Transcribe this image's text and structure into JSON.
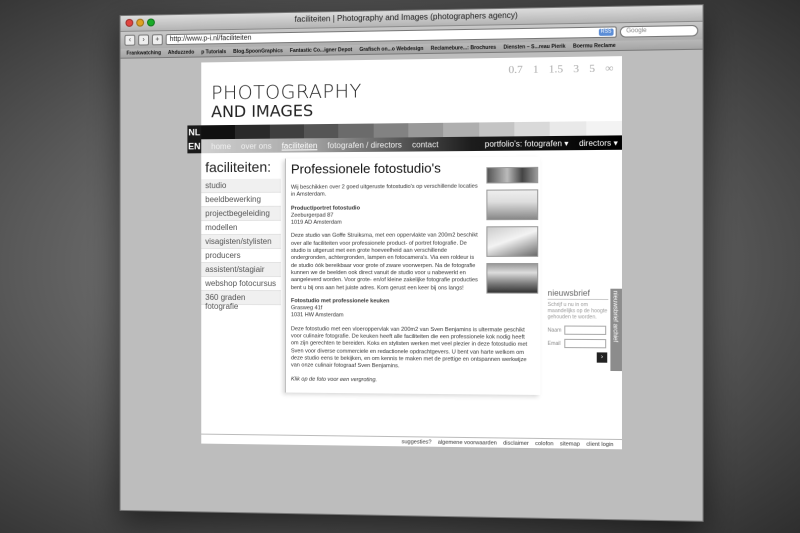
{
  "window": {
    "title": "faciliteiten | Photography and Images (photographers agency)",
    "url": "http://www.p-i.nl/faciliteiten",
    "rss_label": "RSS",
    "search_placeholder": "Google",
    "bookmarks": [
      "Frankwatching",
      "Ahduzzedo",
      "p Tutorials",
      "Blog.SpoonGraphics",
      "Fantastic Co...igner Depot",
      "Grafisch on...o Webdesign",
      "Reclamebure...: Brochures",
      "Diensten – S...reau Pierik",
      "Boermu Reclame"
    ]
  },
  "logo": {
    "line1": "PHOTOGRAPHY",
    "line2": "AND IMAGES"
  },
  "apertures": "0.7 1 1.5 3 5 ∞",
  "strip_colors": [
    "#111111",
    "#2a2a2a",
    "#3f3f3f",
    "#555555",
    "#6b6b6b",
    "#828282",
    "#999999",
    "#afafaf",
    "#c4c4c4",
    "#d9d9d9",
    "#e9e9e9",
    "#f3f3f3"
  ],
  "lang": {
    "nl": "NL",
    "en": "EN"
  },
  "nav": {
    "items": [
      "home",
      "over ons",
      "faciliteiten",
      "fotografen / directors",
      "contact"
    ],
    "active": "faciliteiten",
    "portfolio": "portfolio's: fotografen ▾",
    "directors": "directors ▾"
  },
  "sidebar": {
    "title": "faciliteiten:",
    "items": [
      "studio",
      "beeldbewerking",
      "projectbegeleiding",
      "modellen",
      "visagisten/stylisten",
      "producers",
      "assistent/stagiair",
      "webshop fotocursus",
      "360 graden fotografie"
    ]
  },
  "content": {
    "title": "Professionele fotostudio's",
    "intro": "Wij beschikken over 2 goed uitgeruste fotostudio's op verschillende locaties in Amsterdam.",
    "studio1_name": "Product/portret fotostudio",
    "studio1_addr1": "Zeeburgerpad 87",
    "studio1_addr2": "1019 AD  Amsterdam",
    "studio1_text": "Deze studio van Goffe Struiksma, met een oppervlakte van 200m2 beschikt over alle faciliteiten voor professionele product- of portret fotografie. De studio is uitgerust met een grote hoeveelheid aan verschillende ondergronden, achtergronden, lampen en fotocamera's. Via een roldeur is de studio óók bereikbaar voor grote of zware voorwerpen. Na de fotografie kunnen we de beelden ook direct vanuit de studio voor u nabewerkt en aangeleverd worden. Voor grote- en/of kleine zakelijke fotografie producties bent u bij ons aan het juiste adres. Kom gerust een keer bij ons langs!",
    "studio2_name": "Fotostudio met professionele keuken",
    "studio2_addr1": "Grasweg 41f",
    "studio2_addr2": "1031 HW  Amsterdam",
    "studio2_text": "Deze fotostudio met een vloeroppervlak van 200m2 van Sven Benjamins is ultermate geschikt voor culinaire fotografie. De keuken heeft alle faciliteiten die een professionele kok nodig heeft om zijn gerechten te bereiden. Koks en stylisten werken met veel plezier in deze fotostudio met Sven voor diverse commerciele en redactionele opdrachtgevers. U bent van harte welkom om deze studio eens te bekijken, en om kennis te maken met de prettige en ontspannen werkwijze van onze culinair fotograaf Sven Benjamins.",
    "note": "Klik op de foto voor een vergroting."
  },
  "newsletter": {
    "title": "nieuwsbrief",
    "subtitle": "Schrijf u nu in om maandelijks op de hoogte gehouden te worden.",
    "name_label": "Naam",
    "email_label": "Email",
    "submit": "›",
    "archive": "nieuwsbrief archief"
  },
  "footer": [
    "suggesties?",
    "algemene voorwaarden",
    "disclaimer",
    "colofon",
    "sitemap",
    "client login"
  ]
}
